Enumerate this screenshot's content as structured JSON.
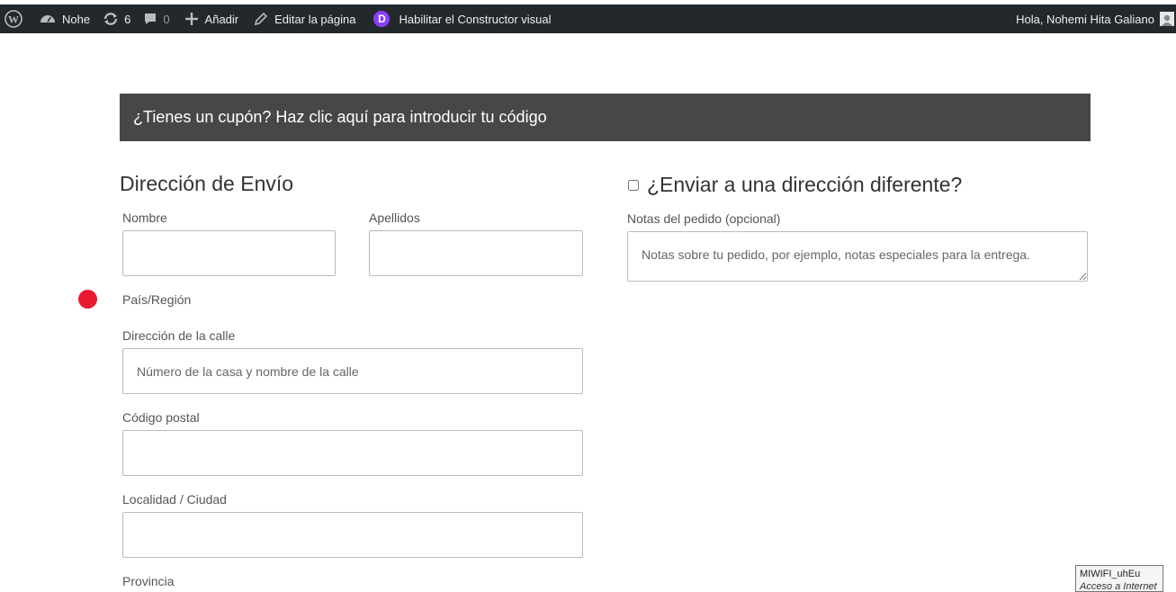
{
  "adminbar": {
    "site_name": "Nohe",
    "updates_count": "6",
    "comments_count": "0",
    "new_label": "Añadir",
    "edit_label": "Editar la página",
    "divi_letter": "D",
    "visual_builder_label": "Habilitar el Constructor visual",
    "greeting": "Hola, Nohemi Hita Galiano"
  },
  "coupon": {
    "text": "¿Tienes un cupón? Haz clic aquí para introducir tu código"
  },
  "shipping": {
    "heading": "Dirección de Envío",
    "first_name_label": "Nombre",
    "last_name_label": "Apellidos",
    "country_label": "País/Región",
    "street_label": "Dirección de la calle",
    "street_placeholder": "Número de la casa y nombre de la calle",
    "postcode_label": "Código postal",
    "city_label": "Localidad / Ciudad",
    "province_label": "Provincia"
  },
  "different_address": {
    "heading": "¿Enviar a una dirección diferente?",
    "notes_label": "Notas del pedido (opcional)",
    "notes_placeholder": "Notas sobre tu pedido, por ejemplo, notas especiales para la entrega."
  },
  "tooltip": {
    "line1": "MIWIFI_uhEu",
    "line2": "Acceso a Internet"
  },
  "colors": {
    "adminbar": "#23282d",
    "coupon_bg": "#474747",
    "marker": "#e81a2f",
    "divi": "#8a3ffc"
  }
}
